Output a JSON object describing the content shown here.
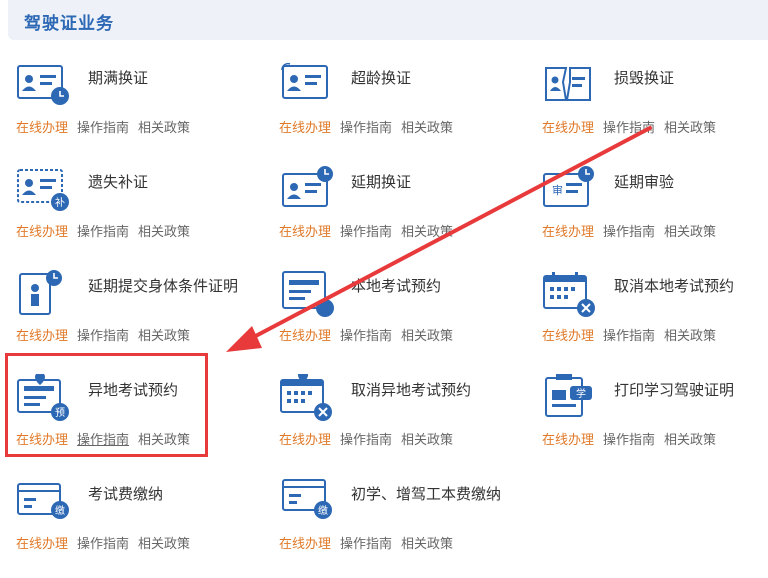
{
  "header": {
    "title": "驾驶证业务"
  },
  "links": {
    "online": "在线办理",
    "guide": "操作指南",
    "policy": "相关政策"
  },
  "items": [
    {
      "title": "期满换证",
      "icon": "id-card-clock-icon"
    },
    {
      "title": "超龄换证",
      "icon": "id-card-refresh-icon"
    },
    {
      "title": "损毁换证",
      "icon": "damaged-card-icon"
    },
    {
      "title": "遗失补证",
      "icon": "lost-card-supplement-icon"
    },
    {
      "title": "延期换证",
      "icon": "id-card-clock-icon"
    },
    {
      "title": "延期审验",
      "icon": "review-clock-icon"
    },
    {
      "title": "延期提交身体条件证明",
      "icon": "health-certificate-icon"
    },
    {
      "title": "本地考试预约",
      "icon": "local-exam-appointment-icon"
    },
    {
      "title": "取消本地考试预约",
      "icon": "cancel-calendar-icon"
    },
    {
      "title": "异地考试预约",
      "icon": "remote-exam-appointment-icon"
    },
    {
      "title": "取消异地考试预约",
      "icon": "cancel-calendar-icon"
    },
    {
      "title": "打印学习驾驶证明",
      "icon": "print-learning-permit-icon"
    },
    {
      "title": "考试费缴纳",
      "icon": "exam-fee-payment-icon"
    },
    {
      "title": "初学、增驾工本费缴纳",
      "icon": "fee-payment-icon"
    }
  ],
  "badges": {
    "supplement": "补",
    "appointment": "预",
    "payment": "缴",
    "review": "审",
    "learn": "学"
  },
  "colors": {
    "accent": "#2d68b4",
    "online": "#e07a2a",
    "highlight": "#e8393b"
  }
}
